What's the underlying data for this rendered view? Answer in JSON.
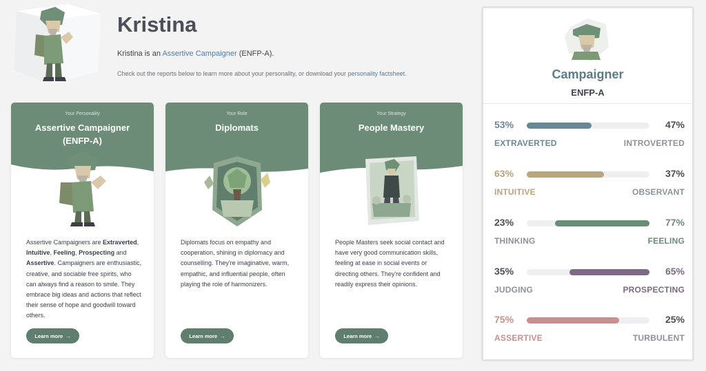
{
  "header": {
    "name": "Kristina",
    "intro_prefix": "Kristina is an",
    "intro_link": "Assertive Campaigner",
    "intro_suffix": "(ENFP-A).",
    "hint_prefix": "Check out the reports below to learn more about your personality, or download your",
    "hint_link": "personality factsheet",
    "hint_suffix": "."
  },
  "cards": [
    {
      "eyebrow": "Your Personality",
      "title_line1": "Assertive Campaigner",
      "title_line2": "(ENFP-A)",
      "text_parts": [
        {
          "t": "Assertive Campaigners are ",
          "b": false
        },
        {
          "t": "Extraverted",
          "b": true
        },
        {
          "t": ", ",
          "b": false
        },
        {
          "t": "Intuitive",
          "b": true
        },
        {
          "t": ", ",
          "b": false
        },
        {
          "t": "Feeling",
          "b": true
        },
        {
          "t": ", ",
          "b": false
        },
        {
          "t": "Prospecting",
          "b": true
        },
        {
          "t": " and ",
          "b": false
        },
        {
          "t": "Assertive",
          "b": true
        },
        {
          "t": ". Campaigners are enthusiastic, creative, and sociable free spirits, who can always find a reason to smile. They embrace big ideas and actions that reflect their sense of hope and goodwill toward others.",
          "b": false
        }
      ],
      "button": "Learn more",
      "button_icon": "arrow-right-icon"
    },
    {
      "eyebrow": "Your Role",
      "title_line1": "Diplomats",
      "title_line2": "",
      "text_parts": [
        {
          "t": "Diplomats focus on empathy and cooperation, shining in diplomacy and counselling. They're imaginative, warm, empathic, and influential people, often playing the role of harmonizers.",
          "b": false
        }
      ],
      "button": "Learn more",
      "button_icon": "arrow-right-icon"
    },
    {
      "eyebrow": "Your Strategy",
      "title_line1": "People Mastery",
      "title_line2": "",
      "text_parts": [
        {
          "t": "People Masters seek social contact and have very good communication skills, feeling at ease in social events or directing others. They're confident and readily express their opinions.",
          "b": false
        }
      ],
      "button": "Learn more",
      "button_icon": "arrow-right-icon"
    }
  ],
  "panel": {
    "title": "Campaigner",
    "code": "ENFP-A",
    "traits": [
      {
        "left_pct": "53%",
        "right_pct": "47%",
        "left_label": "EXTRAVERTED",
        "right_label": "INTROVERTED",
        "value": 0.53,
        "fill_from": "left",
        "dominant": "left",
        "color": "#6a8795"
      },
      {
        "left_pct": "63%",
        "right_pct": "37%",
        "left_label": "INTUITIVE",
        "right_label": "OBSERVANT",
        "value": 0.63,
        "fill_from": "left",
        "dominant": "left",
        "color": "#b9a47e"
      },
      {
        "left_pct": "23%",
        "right_pct": "77%",
        "left_label": "THINKING",
        "right_label": "FEELING",
        "value": 0.77,
        "fill_from": "right",
        "dominant": "right",
        "color": "#6a8d78"
      },
      {
        "left_pct": "35%",
        "right_pct": "65%",
        "left_label": "JUDGING",
        "right_label": "PROSPECTING",
        "value": 0.65,
        "fill_from": "right",
        "dominant": "right",
        "color": "#7c6a85"
      },
      {
        "left_pct": "75%",
        "right_pct": "25%",
        "left_label": "ASSERTIVE",
        "right_label": "TURBULENT",
        "value": 0.75,
        "fill_from": "left",
        "dominant": "left",
        "color": "#c98e8e"
      }
    ]
  },
  "colors": {
    "card_band": "#6c8c77",
    "accent_link": "#4f7ba6",
    "button": "#5f7e6d"
  }
}
